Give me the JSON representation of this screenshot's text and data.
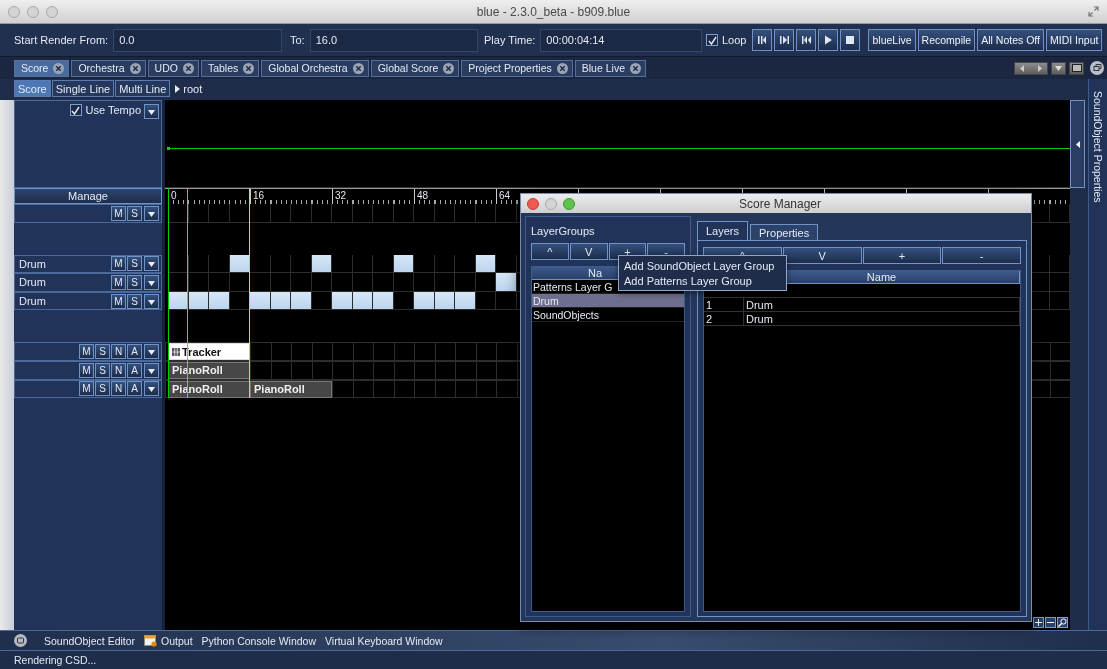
{
  "window": {
    "title": "blue - 2.3.0_beta - b909.blue"
  },
  "toolbar": {
    "render_start": {
      "label": "Start Render From:",
      "value": "0.0"
    },
    "render_end": {
      "label": "To:",
      "value": "16.0"
    },
    "play_time": {
      "label": "Play Time:",
      "value": "00:00:04:14"
    },
    "loop": {
      "label": "Loop",
      "checked": true
    },
    "buttons": [
      "blueLive",
      "Recompile",
      "All Notes Off",
      "MIDI Input"
    ]
  },
  "tabs": [
    {
      "label": "Score",
      "selected": true
    },
    {
      "label": "Orchestra",
      "selected": false
    },
    {
      "label": "UDO",
      "selected": false
    },
    {
      "label": "Tables",
      "selected": false
    },
    {
      "label": "Global Orchestra",
      "selected": false
    },
    {
      "label": "Global Score",
      "selected": false
    },
    {
      "label": "Project Properties",
      "selected": false
    },
    {
      "label": "Blue Live",
      "selected": false
    }
  ],
  "score_tabs": [
    {
      "label": "Score",
      "selected": true
    },
    {
      "label": "Single Line",
      "selected": false
    },
    {
      "label": "Multi Line",
      "selected": false
    }
  ],
  "breadcrumb": "root",
  "tempo": {
    "label": "Use Tempo",
    "checked": true
  },
  "manage_button": "Manage",
  "ruler": [
    "0",
    "16",
    "32",
    "48",
    "64"
  ],
  "layer_groups": [
    {
      "kind": "pattern",
      "layers": [
        {
          "buttons": [
            "M",
            "S"
          ],
          "steps": [
            false,
            false,
            false,
            false,
            false,
            false,
            false,
            false,
            false,
            false,
            false,
            false,
            false,
            false,
            false,
            false,
            false
          ]
        }
      ]
    },
    {
      "kind": "pattern",
      "layers": [
        {
          "name": "Drum",
          "buttons": [
            "M",
            "S"
          ],
          "steps": [
            false,
            false,
            false,
            true,
            false,
            false,
            false,
            true,
            false,
            false,
            false,
            true,
            false,
            false,
            false,
            true,
            false
          ]
        },
        {
          "name": "Drum",
          "buttons": [
            "M",
            "S"
          ],
          "steps": [
            false,
            false,
            false,
            false,
            false,
            false,
            false,
            false,
            false,
            false,
            false,
            false,
            false,
            false,
            false,
            false,
            true
          ]
        },
        {
          "name": "Drum",
          "buttons": [
            "M",
            "S"
          ],
          "steps": [
            true,
            true,
            true,
            false,
            true,
            true,
            true,
            false,
            true,
            true,
            true,
            false,
            true,
            true,
            true,
            false,
            false
          ]
        }
      ]
    },
    {
      "kind": "soundobject",
      "layers": [
        {
          "buttons": [
            "M",
            "S",
            "N",
            "A"
          ],
          "objects": [
            {
              "kind": "tracker",
              "label": "Tracker"
            }
          ]
        },
        {
          "buttons": [
            "M",
            "S",
            "N",
            "A"
          ],
          "objects": [
            {
              "kind": "pianoroll",
              "label": "PianoRoll"
            }
          ]
        },
        {
          "buttons": [
            "M",
            "S",
            "N",
            "A"
          ],
          "objects": [
            {
              "kind": "pianoroll",
              "label": "PianoRoll"
            },
            {
              "kind": "pianoroll",
              "label": "PianoRoll"
            }
          ]
        }
      ]
    }
  ],
  "score_manager": {
    "title": "Score Manager",
    "layer_groups": {
      "title": "LayerGroups",
      "buttons": [
        "^",
        "V",
        "+",
        "-"
      ],
      "header": "Na",
      "rows": [
        {
          "label": "Patterns Layer G",
          "selected": false
        },
        {
          "label": "Drum",
          "selected": true
        },
        {
          "label": "SoundObjects",
          "selected": false
        }
      ]
    },
    "tabs": [
      {
        "label": "Layers",
        "selected": true
      },
      {
        "label": "Properties",
        "selected": false
      }
    ],
    "layers": {
      "buttons": [
        "^",
        "V",
        "+",
        "-"
      ],
      "header": "Name",
      "rows": [
        {
          "index": "1",
          "name": "Drum"
        },
        {
          "index": "2",
          "name": "Drum"
        }
      ]
    },
    "menu": [
      "Add SoundObject Layer Group",
      "Add Patterns Layer Group"
    ]
  },
  "side_panel": {
    "title": "SoundObject Properties"
  },
  "tool_windows": [
    {
      "kind": "plain",
      "label": "SoundObject Editor"
    },
    {
      "kind": "output",
      "label": "Output"
    },
    {
      "kind": "plain",
      "label": "Python Console Window"
    },
    {
      "kind": "plain",
      "label": "Virtual Keyboard Window"
    }
  ],
  "status": "Rendering CSD..."
}
